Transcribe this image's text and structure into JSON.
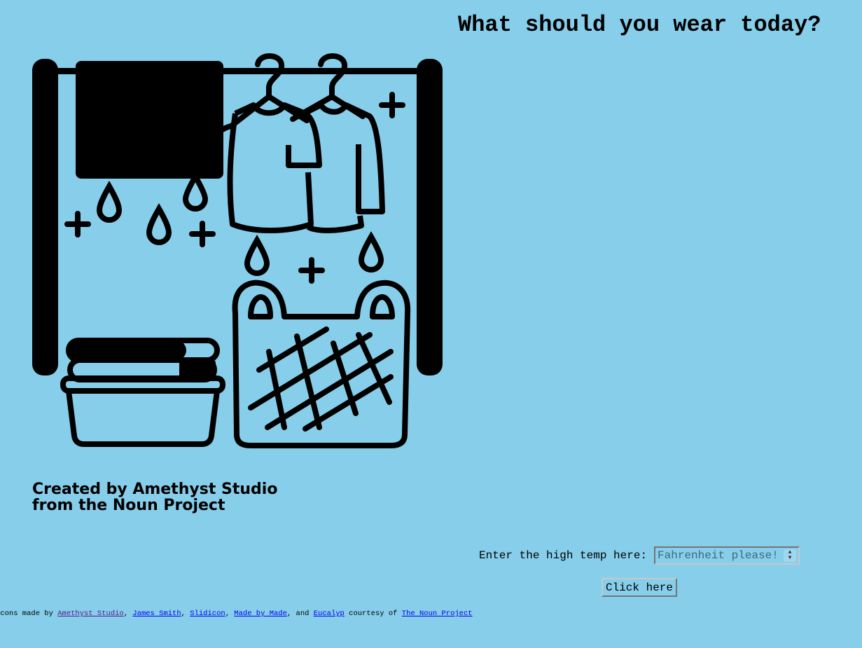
{
  "page": {
    "title": "What should you wear today?",
    "background": "#87ceeb"
  },
  "illustration": {
    "icon": "laundry-icon",
    "credit_line1": "Created by Amethyst Studio",
    "credit_line2": "from the Noun Project"
  },
  "form": {
    "label": "Enter the high temp here:",
    "input_placeholder": "Fahrenheit please!",
    "button_label": "Click here"
  },
  "footer": {
    "prefix": "Icons made by ",
    "sep1": ", ",
    "sep2": ", ",
    "sep3": ", ",
    "sep4": ", and ",
    "courtesy": " courtesy of ",
    "links": [
      {
        "label": "Amethyst Studio",
        "color": "#551a8b"
      },
      {
        "label": "James Smith",
        "color": "#0000ee"
      },
      {
        "label": "Slidicon",
        "color": "#0000ee"
      },
      {
        "label": "Made by Made",
        "color": "#0000ee"
      },
      {
        "label": "Eucalyp",
        "color": "#0000ee"
      },
      {
        "label": "The Noun Project",
        "color": "#0000ee"
      }
    ]
  }
}
